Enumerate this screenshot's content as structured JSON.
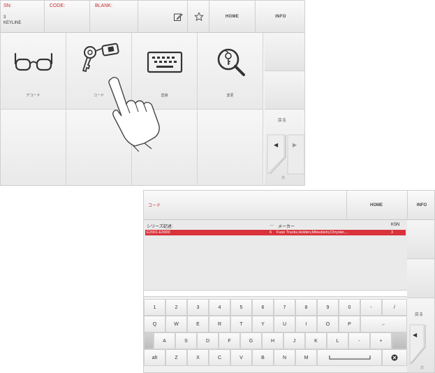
{
  "screen1": {
    "header": {
      "sn_label": "SN:",
      "sn_value": "3",
      "keyline_text": "KEYLINE",
      "code_label": "CODE:",
      "blank_label": "BLANK:",
      "home_label": "HOME",
      "info_label": "INFO"
    },
    "menu": {
      "decode_label": "デコード",
      "code_label": "コード",
      "direct_label": "直接",
      "change_label": "変更"
    },
    "nav": {
      "back_label": "戻る",
      "next_label": "次"
    }
  },
  "screen2": {
    "title": "コード",
    "home_label": "HOME",
    "info_label": "INFO",
    "table": {
      "headers": [
        "シリーズ記述:",
        "...",
        "メーカー",
        "KSN"
      ],
      "rows": [
        [
          "E2001-E3000",
          "6",
          "Fuso Trucks,Holden,Mitsubishi,Chrysler,...",
          "3"
        ]
      ]
    },
    "keyboard": {
      "row1": [
        "1",
        "2",
        "3",
        "4",
        "5",
        "6",
        "7",
        "8",
        "9",
        "0",
        "-",
        "/"
      ],
      "row2": [
        "Q",
        "W",
        "E",
        "R",
        "T",
        "Y",
        "U",
        "I",
        "O",
        "P",
        "←"
      ],
      "row3": [
        "A",
        "S",
        "D",
        "F",
        "G",
        "H",
        "J",
        "K",
        "L",
        "-",
        "+"
      ],
      "row4": [
        "alt",
        "Z",
        "X",
        "C",
        "V",
        "B",
        "N",
        "M",
        "",
        "⊗"
      ]
    },
    "nav": {
      "back_label": "戻る",
      "next_label": "次"
    }
  },
  "colors": {
    "accent": "#c8282e",
    "selected_row": "#d9323a"
  }
}
